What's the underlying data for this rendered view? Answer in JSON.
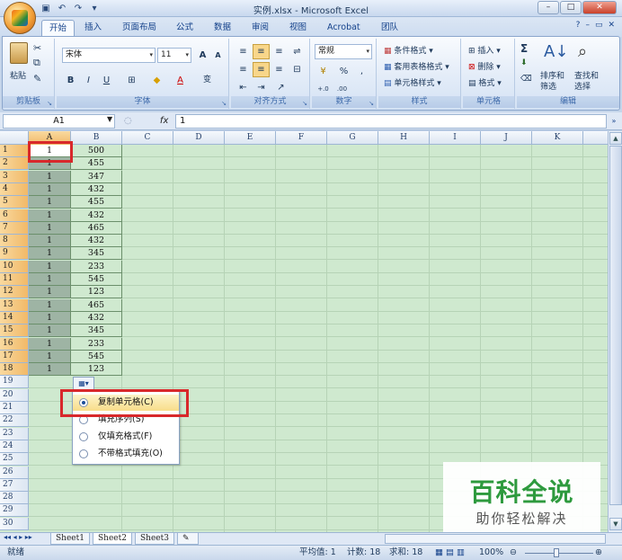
{
  "window": {
    "title": "实例.xlsx - Microsoft Excel",
    "min": "–",
    "max": "□",
    "close": "✕"
  },
  "tabs": [
    "开始",
    "插入",
    "页面布局",
    "公式",
    "数据",
    "审阅",
    "视图",
    "Acrobat",
    "团队"
  ],
  "active_tab": 0,
  "ribbon_right": [
    "?",
    "–",
    "▭",
    "✕"
  ],
  "ribbon": {
    "clipboard": {
      "paste": "粘贴",
      "label": "剪贴板"
    },
    "font": {
      "name": "宋体",
      "size": "11",
      "label": "字体",
      "bold": "B",
      "italic": "I",
      "underline": "U",
      "grow": "A",
      "shrink": "A",
      "phonetic": "变"
    },
    "alignment": {
      "label": "对齐方式"
    },
    "number": {
      "format": "常规",
      "percent": "%",
      "comma": ",",
      "label": "数字"
    },
    "styles": {
      "cond": "条件格式",
      "table": "套用表格格式",
      "cell": "单元格样式",
      "label": "样式"
    },
    "cells": {
      "insert": "插入",
      "delete": "删除",
      "format": "格式",
      "label": "单元格"
    },
    "editing": {
      "sum": "Σ",
      "sort": "排序和",
      "sort2": "筛选",
      "find": "查找和",
      "find2": "选择",
      "label": "编辑"
    }
  },
  "formula_bar": {
    "name_box": "A1",
    "fx": "fx",
    "value": "1"
  },
  "columns": [
    "A",
    "B",
    "C",
    "D",
    "E",
    "F",
    "G",
    "H",
    "I",
    "J",
    "K"
  ],
  "rows": [
    "1",
    "2",
    "3",
    "4",
    "5",
    "6",
    "7",
    "8",
    "9",
    "10",
    "11",
    "12",
    "13",
    "14",
    "15",
    "16",
    "17",
    "18",
    "19",
    "20",
    "21",
    "22",
    "23",
    "24",
    "25",
    "26",
    "27",
    "28",
    "29",
    "30"
  ],
  "colA": [
    "1",
    "1",
    "1",
    "1",
    "1",
    "1",
    "1",
    "1",
    "1",
    "1",
    "1",
    "1",
    "1",
    "1",
    "1",
    "1",
    "1",
    "1"
  ],
  "colB": [
    "500",
    "455",
    "347",
    "432",
    "455",
    "432",
    "465",
    "432",
    "345",
    "233",
    "545",
    "123",
    "465",
    "432",
    "345",
    "233",
    "545",
    "123"
  ],
  "autofill_menu": [
    {
      "label": "复制单元格(C)",
      "checked": true
    },
    {
      "label": "填充序列(S)",
      "checked": false
    },
    {
      "label": "仅填充格式(F)",
      "checked": false
    },
    {
      "label": "不带格式填充(O)",
      "checked": false
    }
  ],
  "sheets": [
    "Sheet1",
    "Sheet2",
    "Sheet3"
  ],
  "active_sheet": 1,
  "status": {
    "mode": "就绪",
    "average": "平均值: 1",
    "count": "计数: 18",
    "sum": "求和: 18",
    "zoom": "100%"
  },
  "watermark": {
    "big": "百科全说",
    "small": "助你轻松解决"
  }
}
